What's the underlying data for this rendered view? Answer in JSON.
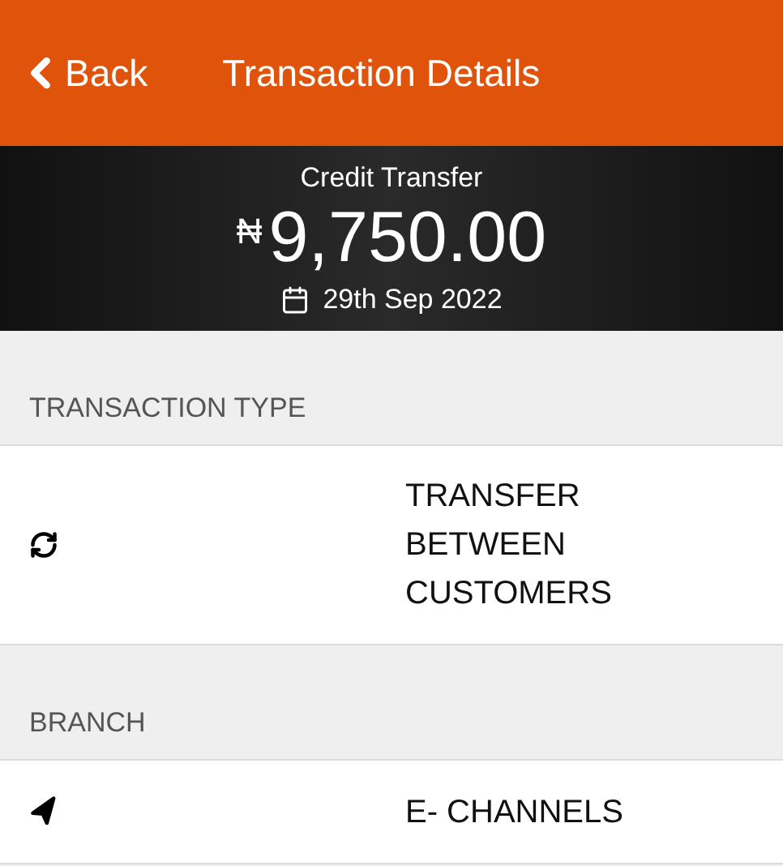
{
  "header": {
    "back": "Back",
    "title": "Transaction Details"
  },
  "summary": {
    "type": "Credit Transfer",
    "currency": "₦",
    "amount": "9,750.00",
    "date": "29th Sep 2022"
  },
  "sections": [
    {
      "heading": "TRANSACTION TYPE",
      "kind": "transfer",
      "value": "TRANSFER BETWEEN CUSTOMERS"
    },
    {
      "heading": "BRANCH",
      "kind": "location",
      "value": "E- CHANNELS"
    }
  ]
}
